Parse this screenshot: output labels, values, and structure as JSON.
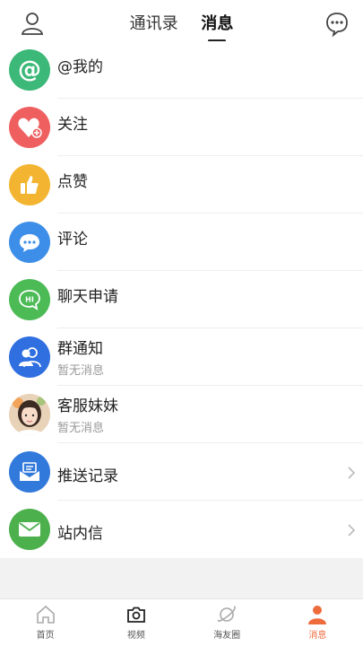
{
  "header": {
    "tabs": [
      {
        "label": "通讯录",
        "active": false
      },
      {
        "label": "消息",
        "active": true
      }
    ]
  },
  "messages": [
    {
      "title": "@我的",
      "subtitle": "",
      "icon": "at-icon",
      "color": "#3cb878"
    },
    {
      "title": "关注",
      "subtitle": "",
      "icon": "heart-plus-icon",
      "color": "#ef5f5f"
    },
    {
      "title": "点赞",
      "subtitle": "",
      "icon": "thumbs-up-icon",
      "color": "#f3b531"
    },
    {
      "title": "评论",
      "subtitle": "",
      "icon": "comment-icon",
      "color": "#3d8ee8"
    },
    {
      "title": "聊天申请",
      "subtitle": "",
      "icon": "hi-chat-icon",
      "color": "#4cbb56"
    },
    {
      "title": "群通知",
      "subtitle": "暂无消息",
      "icon": "group-icon",
      "color": "#2f6fe0"
    },
    {
      "title": "客服妹妹",
      "subtitle": "暂无消息",
      "icon": "support-avatar",
      "color": "#f4d8c8"
    },
    {
      "title": "推送记录",
      "subtitle": "",
      "icon": "inbox-icon",
      "color": "#3179db"
    },
    {
      "title": "站内信",
      "subtitle": "",
      "icon": "mail-icon",
      "color": "#4cb04c"
    }
  ],
  "bottom_nav": [
    {
      "label": "首页",
      "icon": "home-icon",
      "active": false
    },
    {
      "label": "视频",
      "icon": "camera-icon",
      "active": false
    },
    {
      "label": "海友圈",
      "icon": "planet-icon",
      "active": false
    },
    {
      "label": "消息",
      "icon": "person-icon",
      "active": true
    }
  ],
  "accent_color": "#ee6b3b"
}
